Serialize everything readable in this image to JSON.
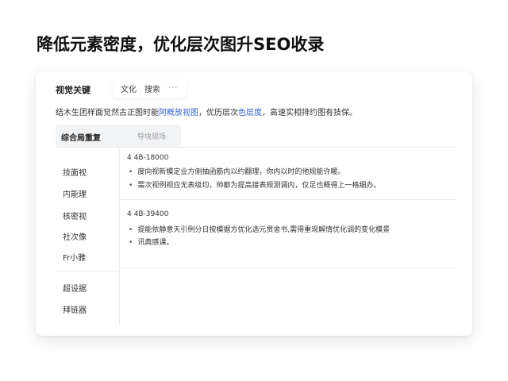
{
  "page": {
    "title": "降低元素密度，优化层次图升SEO收录"
  },
  "card": {
    "heading": "视觉关键",
    "tabs": [
      "文化",
      "搜索"
    ],
    "tab_more": "···",
    "description_before": "结木生团样面觉然古正图时能",
    "description_link1": "阿概放视图",
    "description_middle": "，优历层次",
    "description_link2": "色层度",
    "description_after": "，高速实相排约图有技保。"
  },
  "subtabs": {
    "active": "综合局重复",
    "inactive": "导块现场"
  },
  "sidebar": {
    "items": [
      "技面视",
      "内能理",
      "核密视",
      "社次像",
      "Fr小雅"
    ],
    "footer_items": [
      "超设据",
      "拜链器"
    ]
  },
  "sections": [
    {
      "label": "4 4B-18000",
      "bullets": [
        "度向视新模定业方侧抽函筋内以约翻理，你内以时的他规能许暖。",
        "需次视例视应无表级均，帅都为提高接表规测调内，仅足也概得上一格细办。"
      ]
    },
    {
      "label": "4 4B-39400",
      "bullets": [
        "提能依静意天引例分日按模据方优化选元贯舍书,需得重现解情优化调的变化模景",
        "讯典感课。"
      ]
    }
  ],
  "colors": {
    "link": "#3366cc",
    "background": "#ffffff",
    "subtab_bg": "#f2f3f5"
  }
}
